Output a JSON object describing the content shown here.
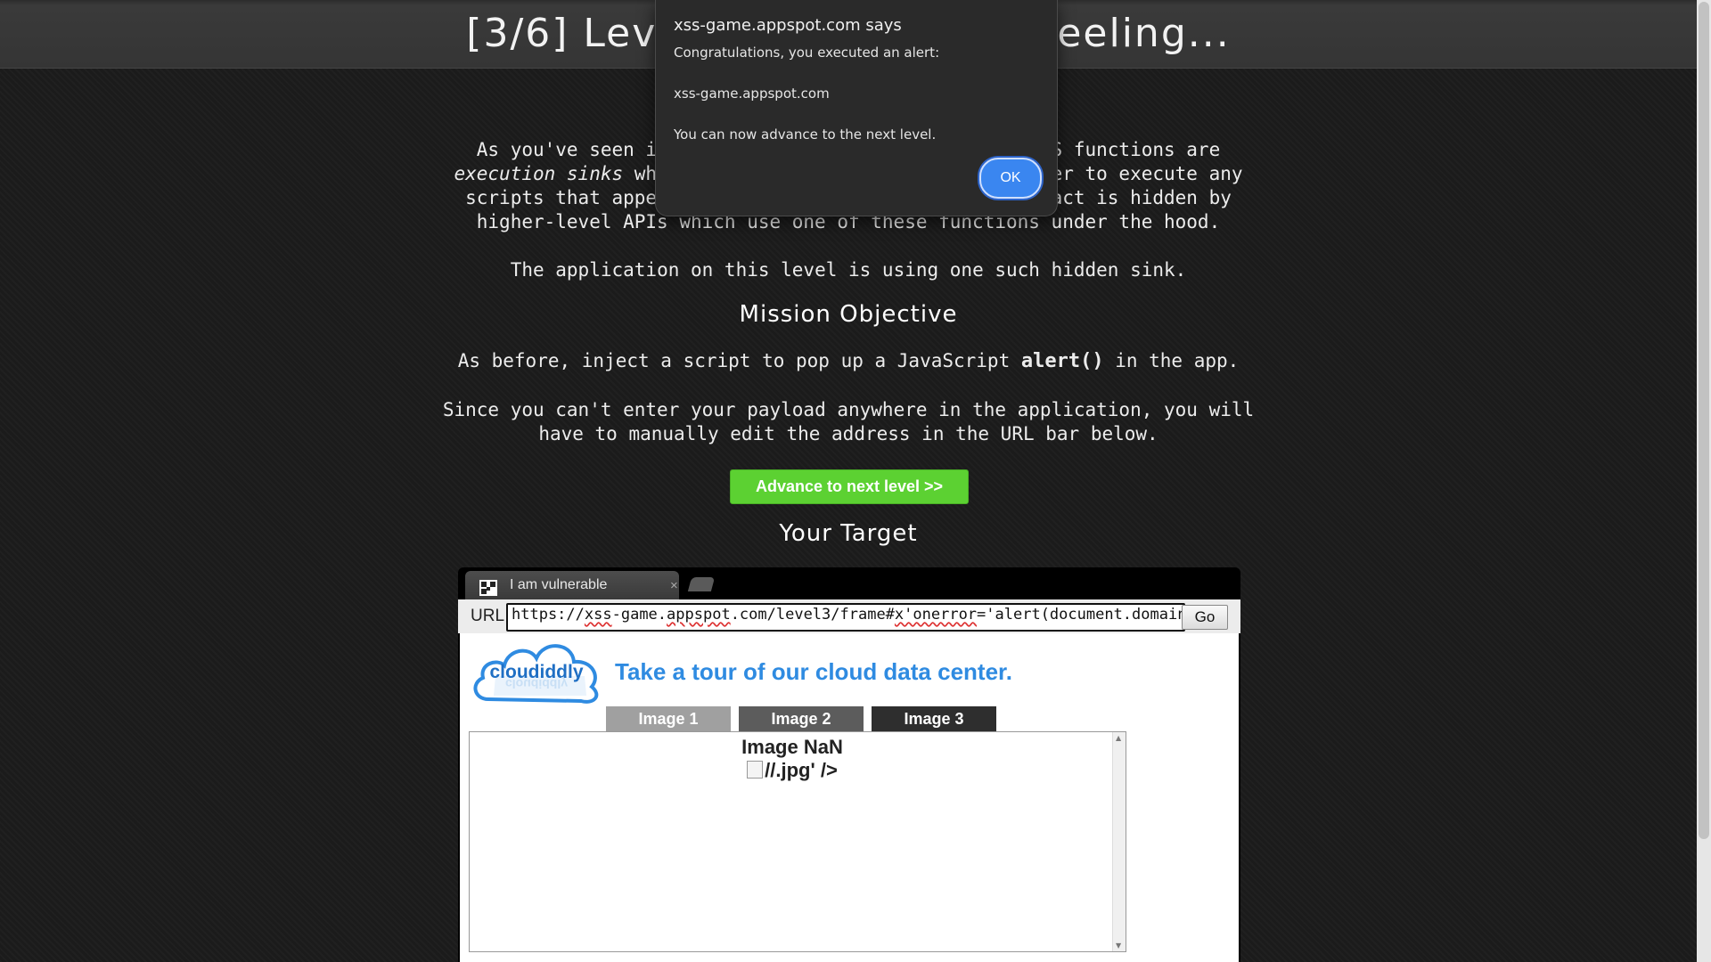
{
  "header": {
    "title": "[3/6] Level 3: That sinking feeling..."
  },
  "intro": {
    "line1": "As you've seen in the previous level, some common JS functions are",
    "line2_em": "execution sinks",
    "line2_rest": " which means they will cause the browser to execute any",
    "line3": "scripts that appear in their input. Sometimes this fact is hidden by",
    "line4": "higher-level APIs which use one of these functions under the hood.",
    "line5": "The application on this level is using one such hidden sink."
  },
  "mission": {
    "heading": "Mission Objective",
    "objective_prefix": "As before, inject a script to pop up a JavaScript ",
    "objective_code": "alert()",
    "objective_suffix": " in the app.",
    "note_line1": "Since you can't enter your payload anywhere in the application, you will",
    "note_line2": "have to manually edit the address in the URL bar below."
  },
  "advance_button": "Advance to next level >>",
  "target": {
    "heading": "Your Target",
    "tab_title": "I am vulnerable",
    "tab_close": "×",
    "url_label": "URL",
    "url_part1": "https://",
    "url_part2": "xss",
    "url_part3": "-game.",
    "url_part4": "appspot",
    "url_part5": ".com/level3/frame#",
    "url_part6": "x'onerror",
    "url_part7": "='alert(document.domain)'",
    "go_button": "Go",
    "app": {
      "logo_text": "cloudiddly",
      "tagline": "Take a tour of our cloud data center.",
      "image_tabs": [
        "Image 1",
        "Image 2",
        "Image 3"
      ],
      "viewer_title": "Image NaN",
      "viewer_image_text": "//.jpg' />"
    }
  },
  "dialog": {
    "title": "xss-game.appspot.com says",
    "message1": "Congratulations, you executed an alert:",
    "message2": "xss-game.appspot.com",
    "message3": "You can now advance to the next level.",
    "ok_button": "OK"
  },
  "colors": {
    "advance_green": "#5cd132",
    "tagline_blue": "#2f8be1",
    "ok_blue": "#3a86f0",
    "image_tab_1": "#a0a0a0",
    "image_tab_2": "#5c5c5c",
    "image_tab_3": "#2e2e2e"
  },
  "icons": [
    "tab-favicon-icon",
    "close-icon",
    "cloud-logo-icon",
    "broken-image-icon"
  ]
}
